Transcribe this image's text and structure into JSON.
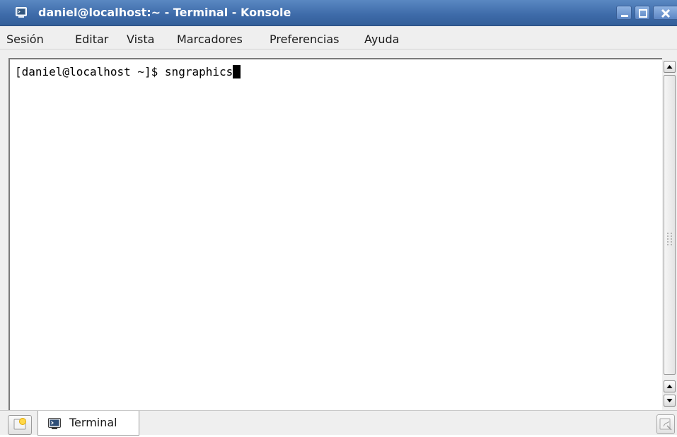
{
  "window": {
    "title": "daniel@localhost:~ - Terminal - Konsole"
  },
  "menu": {
    "items": [
      "Sesión",
      "Editar",
      "Vista",
      "Marcadores",
      "Preferencias",
      "Ayuda"
    ]
  },
  "terminal": {
    "prompt": "[daniel@localhost ~]$ ",
    "command": "sngraphics"
  },
  "tabs": [
    {
      "label": "Terminal",
      "icon": "terminal-icon"
    }
  ],
  "colors": {
    "titlebar": "#3d6aa8",
    "title_text": "#ffffff",
    "terminal_bg": "#ffffff",
    "terminal_fg": "#000000"
  }
}
